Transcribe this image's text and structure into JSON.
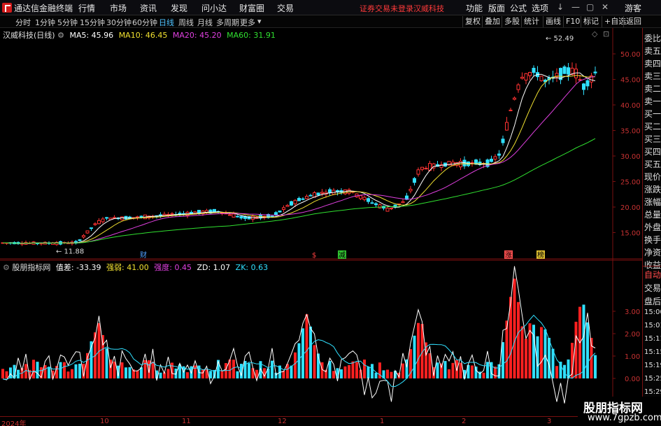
{
  "app": {
    "title": "通达信金融终端",
    "menus": [
      "行情",
      "市场",
      "资讯",
      "发现",
      "问小达",
      "财富圈",
      "交易"
    ],
    "warning": "证券交易未登录",
    "stock_tab": "汉威科技",
    "right_menus": [
      "功能",
      "版面",
      "公式",
      "选项"
    ],
    "guest": "游客"
  },
  "toolbar": {
    "periods": [
      "分时",
      "1分钟",
      "5分钟",
      "15分钟",
      "30分钟",
      "60分钟",
      "日线",
      "周线",
      "月线",
      "多周期",
      "更多"
    ],
    "active": "日线",
    "buttons": [
      "复权",
      "叠加",
      "多股",
      "统计",
      "画线",
      "F10",
      "标记",
      "+自选",
      "返回"
    ]
  },
  "main_chart": {
    "stock_name": "汉威科技(日线)",
    "ma": [
      {
        "label": "MA5: 45.96",
        "color": "#ffffff"
      },
      {
        "label": "MA10: 46.45",
        "color": "#f0e030"
      },
      {
        "label": "MA20: 45.20",
        "color": "#e040e0"
      },
      {
        "label": "MA60: 31.91",
        "color": "#30e030"
      }
    ],
    "high_label": "52.49",
    "low_label": "11.88",
    "y_ticks": [
      "50.00",
      "45.00",
      "40.00",
      "35.00",
      "30.00",
      "25.00",
      "20.00",
      "15.00"
    ],
    "markers": [
      {
        "text": "财",
        "color": "#4fa0ff",
        "bg": "transparent"
      },
      {
        "text": "$",
        "color": "#ff4040",
        "bg": "transparent"
      },
      {
        "text": "减",
        "color": "#000000",
        "bg": "#30c030"
      },
      {
        "text": "涨",
        "color": "#000000",
        "bg": "#ff5050"
      },
      {
        "text": "榜",
        "color": "#000000",
        "bg": "#e0c030"
      }
    ]
  },
  "sub_chart": {
    "name": "股朋指标网",
    "values": [
      {
        "label": "值差: -33.39",
        "color": "#ffffff"
      },
      {
        "label": "强弱: 41.00",
        "color": "#f0e030"
      },
      {
        "label": "强度: 0.45",
        "color": "#e040e0"
      },
      {
        "label": "ZD: 1.07",
        "color": "#ffffff"
      },
      {
        "label": "ZK: 0.63",
        "color": "#30e0ff"
      }
    ],
    "y_ticks": [
      "3.00",
      "2.00",
      "1.00",
      "0.00"
    ]
  },
  "x_axis": [
    "2024年",
    "10",
    "11",
    "12",
    "1",
    "2",
    "3"
  ],
  "right_panel": {
    "top": [
      "委比",
      "卖五",
      "卖四",
      "卖三",
      "卖二",
      "卖一",
      "买一",
      "买二",
      "买三",
      "买四",
      "买五",
      "现价",
      "涨跌",
      "涨幅",
      "总量",
      "外盘",
      "换手",
      "净资",
      "收益"
    ],
    "bottom": [
      "自动",
      "交易",
      "盘后",
      "15:00",
      "15:01",
      "15:11",
      "15:15",
      "15:19",
      "15:25",
      "15:29"
    ]
  },
  "watermark": {
    "line1": "股朋指标网",
    "line2": "www.7gpzb.com"
  }
}
